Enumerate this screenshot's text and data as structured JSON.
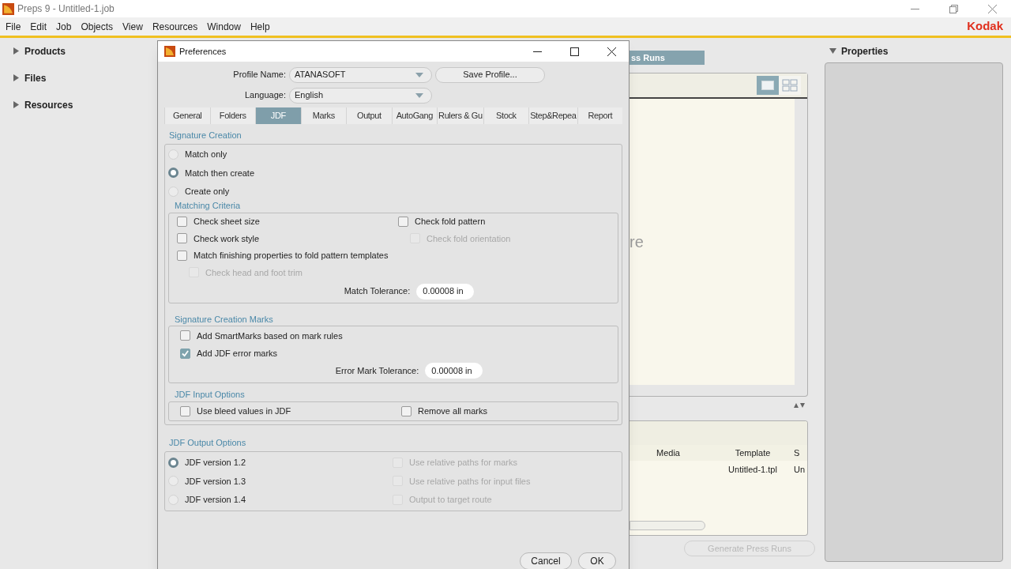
{
  "app": {
    "title": "Preps 9 - Untitled-1.job",
    "menu": [
      "File",
      "Edit",
      "Job",
      "Objects",
      "View",
      "Resources",
      "Window",
      "Help"
    ],
    "logo": "Kodak"
  },
  "left_panel": [
    {
      "label": "Products",
      "expanded": false
    },
    {
      "label": "Files",
      "expanded": false
    },
    {
      "label": "Resources",
      "expanded": false
    }
  ],
  "press_runs": {
    "tab": "ss Runs",
    "view_modes": [
      {
        "kind": "single",
        "selected": true
      },
      {
        "kind": "grid",
        "selected": false
      }
    ],
    "hint": "re"
  },
  "table": {
    "columns": [
      "Media",
      "Template",
      "S"
    ],
    "rows": [
      {
        "template": "Untitled-1.tpl",
        "column_3": "Un"
      }
    ]
  },
  "generate_button": {
    "label": "Generate Press Runs",
    "disabled": true
  },
  "properties": {
    "title": "Properties",
    "expanded": true
  },
  "dialog": {
    "title": "Preferences",
    "profile": {
      "label": "Profile Name:",
      "value": "ATANASOFT"
    },
    "save_profile": "Save Profile...",
    "language": {
      "label": "Language:",
      "value": "English"
    },
    "tabs": [
      {
        "label": "General",
        "selected": false
      },
      {
        "label": "Folders",
        "selected": false
      },
      {
        "label": "JDF",
        "selected": true
      },
      {
        "label": "Marks",
        "selected": false
      },
      {
        "label": "Output",
        "selected": false
      },
      {
        "label": "AutoGang",
        "selected": false
      },
      {
        "label": "Rulers & Gu",
        "selected": false
      },
      {
        "label": "Stock",
        "selected": false
      },
      {
        "label": "Step&Repea",
        "selected": false
      },
      {
        "label": "Report",
        "selected": false
      }
    ],
    "signature_creation": {
      "title": "Signature Creation",
      "options": [
        {
          "label": "Match only",
          "selected": false
        },
        {
          "label": "Match then create",
          "selected": true
        },
        {
          "label": "Create only",
          "selected": false
        }
      ],
      "matching_criteria": {
        "title": "Matching Criteria",
        "left": [
          {
            "label": "Check sheet size",
            "checked": false,
            "disabled": false
          },
          {
            "label": "Check work style",
            "checked": false,
            "disabled": false
          },
          {
            "label": "Match finishing properties to fold pattern templates",
            "checked": false,
            "disabled": false,
            "children": [
              {
                "label": "Check head and foot trim",
                "checked": false,
                "disabled": true
              }
            ]
          }
        ],
        "right": [
          {
            "label": "Check fold pattern",
            "checked": false,
            "disabled": false,
            "children": [
              {
                "label": "Check fold orientation",
                "checked": false,
                "disabled": true
              }
            ]
          }
        ],
        "tolerance": {
          "label": "Match Tolerance:",
          "value": "0.00008 in"
        }
      },
      "marks": {
        "title": "Signature Creation Marks",
        "items": [
          {
            "label": "Add SmartMarks based on mark rules",
            "checked": false,
            "disabled": false
          },
          {
            "label": "Add JDF error marks",
            "checked": true,
            "disabled": false
          }
        ],
        "tolerance": {
          "label": "Error Mark Tolerance:",
          "value": "0.00008 in"
        }
      },
      "input_options": {
        "title": "JDF Input Options",
        "items": [
          {
            "label": "Use bleed values in JDF",
            "checked": false,
            "disabled": false
          },
          {
            "label": "Remove all marks",
            "checked": false,
            "disabled": false
          }
        ]
      }
    },
    "output_options": {
      "title": "JDF Output Options",
      "versions": [
        {
          "label": "JDF version 1.2",
          "selected": true
        },
        {
          "label": "JDF version 1.3",
          "selected": false
        },
        {
          "label": "JDF version 1.4",
          "selected": false
        }
      ],
      "items": [
        {
          "label": "Use relative paths for marks",
          "checked": false,
          "disabled": true
        },
        {
          "label": "Use relative paths for input files",
          "checked": false,
          "disabled": true
        },
        {
          "label": "Output to target route",
          "checked": false,
          "disabled": true
        }
      ]
    },
    "buttons": [
      "Cancel",
      "OK"
    ]
  }
}
